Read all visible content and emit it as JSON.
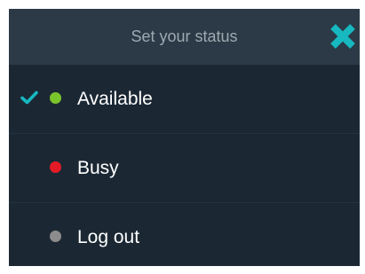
{
  "dialog": {
    "title": "Set your status",
    "close_icon": "close-icon",
    "accent_color": "#17b8c0"
  },
  "statuses": [
    {
      "label": "Available",
      "dot_color": "#7ac42b",
      "selected": true
    },
    {
      "label": "Busy",
      "dot_color": "#e41b26",
      "selected": false
    },
    {
      "label": "Log out",
      "dot_color": "#8c8c8c",
      "selected": false
    }
  ]
}
